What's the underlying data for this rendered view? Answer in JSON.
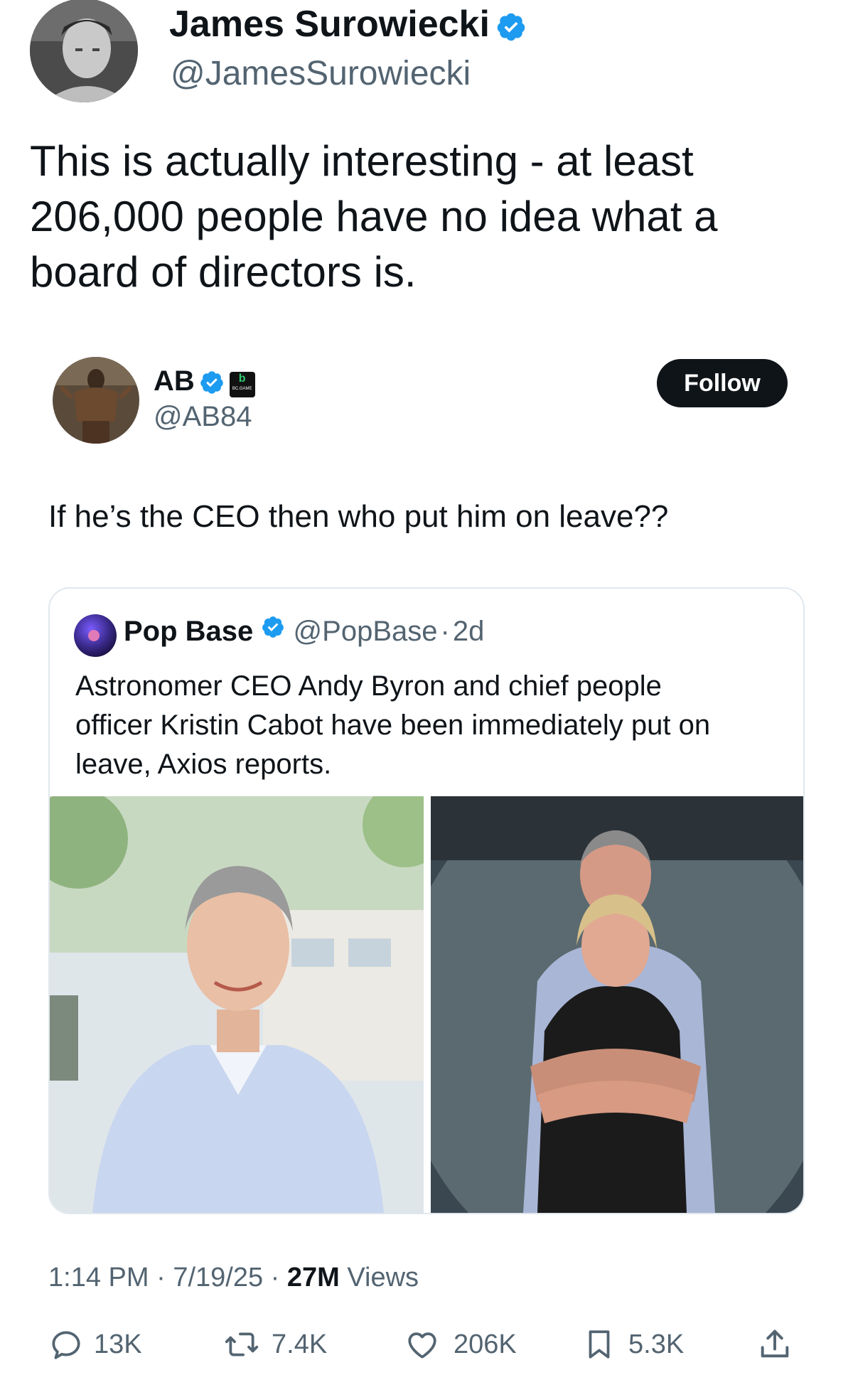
{
  "outer_post": {
    "author": {
      "display_name": "James Surowiecki",
      "handle": "@JamesSurowiecki",
      "verified": true
    },
    "text_lines": [
      "This is actually interesting - at least",
      "206,000 people have no idea what a",
      "board of directors is."
    ]
  },
  "quoted_post": {
    "author": {
      "display_name": "AB",
      "handle": "@AB84",
      "verified": true,
      "affiliate_badge": "BC.GAME"
    },
    "follow_label": "Follow",
    "text": "If he’s the CEO then who put him on leave??"
  },
  "embedded_post": {
    "author": {
      "display_name": "Pop Base",
      "handle": "@PopBase",
      "separator": "·",
      "age": "2d",
      "verified": true
    },
    "text_lines": [
      "Astronomer CEO Andy Byron and chief people",
      "officer Kristin Cabot have been immediately put on",
      "leave, Axios reports."
    ],
    "images": [
      "headshot-photo",
      "concert-kiss-cam-photo"
    ]
  },
  "meta": {
    "time": "1:14 PM",
    "sep1": " · ",
    "date": "7/19/25",
    "sep2": " · ",
    "views_count": "27M",
    "views_label": " Views"
  },
  "actions": {
    "replies": "13K",
    "reposts": "7.4K",
    "likes": "206K",
    "bookmarks": "5.3K"
  },
  "colors": {
    "verified_blue": "#1d9bf0",
    "text": "#0f1419",
    "secondary": "#536471",
    "follow_bg": "#0f1419",
    "border": "#e1e8ed"
  }
}
